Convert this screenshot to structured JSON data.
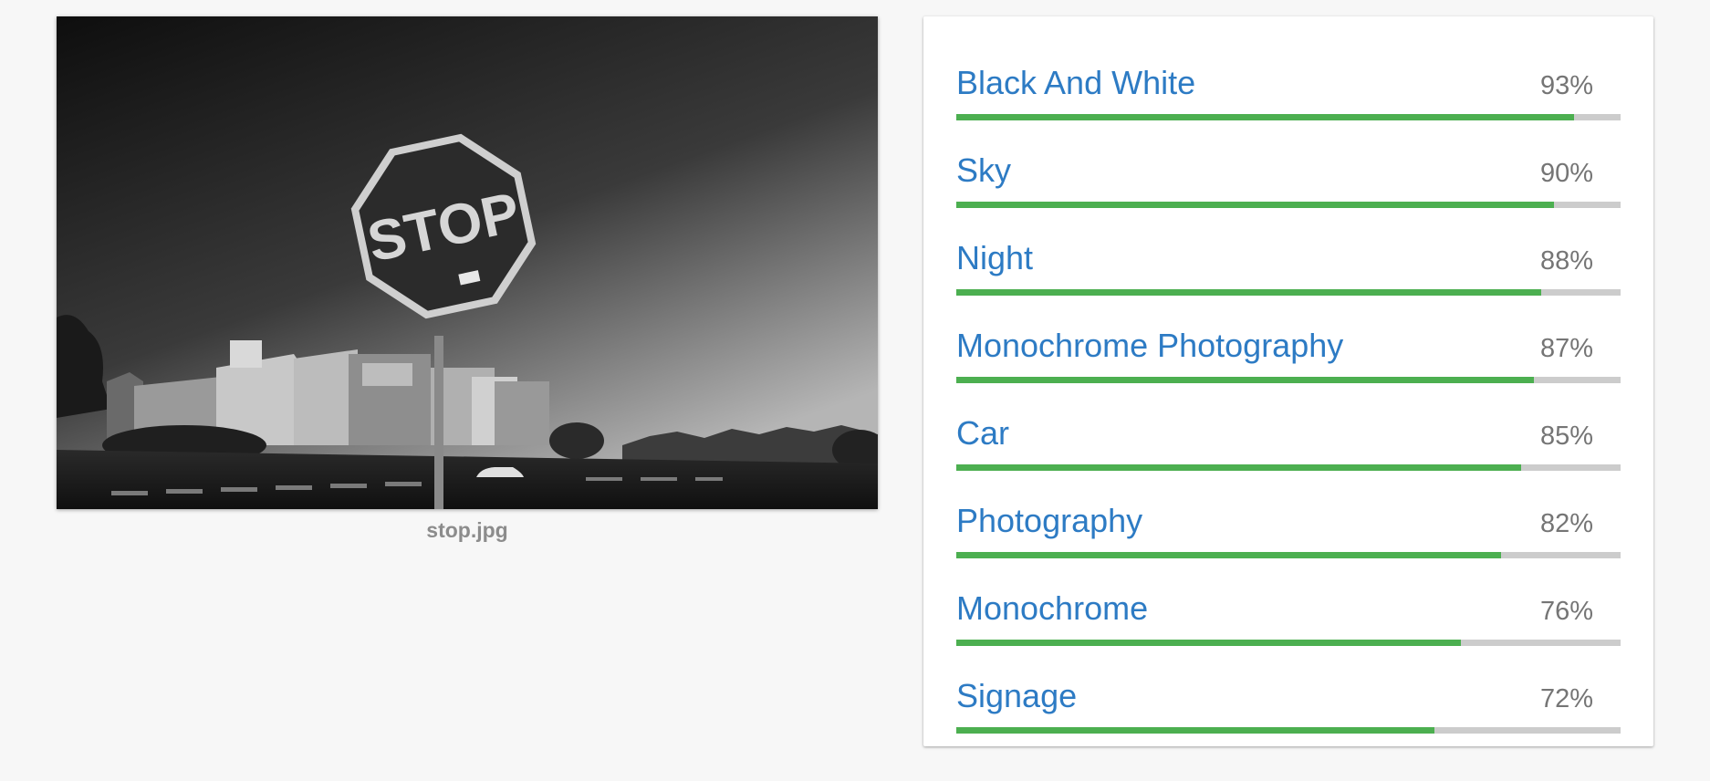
{
  "image": {
    "caption": "stop.jpg",
    "sign_text": "STOP"
  },
  "labels": [
    {
      "name": "Black And White",
      "score": "93%",
      "value": 0.93
    },
    {
      "name": "Sky",
      "score": "90%",
      "value": 0.9
    },
    {
      "name": "Night",
      "score": "88%",
      "value": 0.88
    },
    {
      "name": "Monochrome Photography",
      "score": "87%",
      "value": 0.87
    },
    {
      "name": "Car",
      "score": "85%",
      "value": 0.85
    },
    {
      "name": "Photography",
      "score": "82%",
      "value": 0.82
    },
    {
      "name": "Monochrome",
      "score": "76%",
      "value": 0.76
    },
    {
      "name": "Signage",
      "score": "72%",
      "value": 0.72
    }
  ],
  "colors": {
    "label_text": "#2d7bc4",
    "score_text": "#757575",
    "bar_fill": "#4caf50",
    "bar_track": "#cccccc",
    "background": "#f7f7f7"
  }
}
